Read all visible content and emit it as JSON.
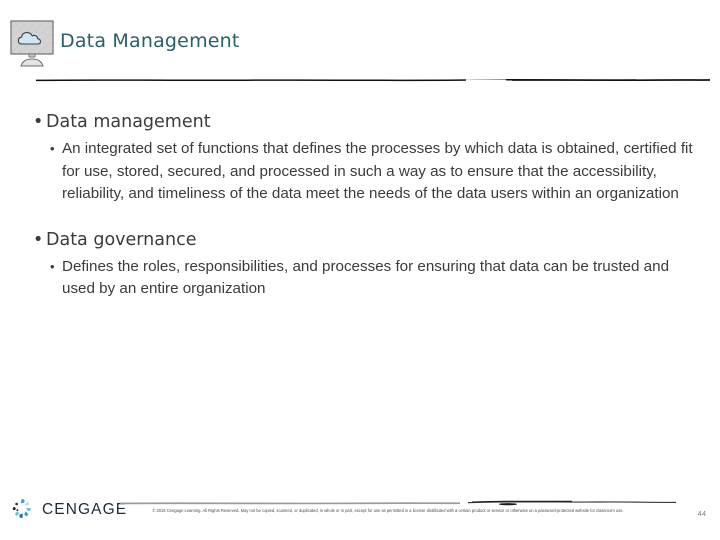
{
  "slide": {
    "header": {
      "title": "Data Management",
      "icon": "cloud-monitor-icon",
      "title_color": "#27606b"
    },
    "content": [
      {
        "level": 1,
        "bullet_glyph": "•",
        "text": "Data management"
      },
      {
        "level": 2,
        "bullet_glyph": "•",
        "text": "An integrated set of functions that defines the processes by which data is obtained, certified fit for use, stored, secured, and processed in such a way as to ensure that the accessibility, reliability, and timeliness of the data meet the needs of the data users within an organization"
      },
      {
        "level": 1,
        "bullet_glyph": "•",
        "text": "Data governance"
      },
      {
        "level": 2,
        "bullet_glyph": "•",
        "text": "Defines the roles, responsibilities, and processes for ensuring that data can be trusted and used by an entire organization"
      }
    ],
    "footer": {
      "logo_word": "CENGAGE",
      "logo_mark": "cengage-swirl-icon",
      "copyright": "© 2019 Cengage Learning. All Rights Reserved. May not be copied, scanned, or duplicated, in whole or in part, except for use as permitted in a license distributed with a certain product or service or otherwise on a password-protected website for classroom use.",
      "page_number": "44"
    },
    "colors": {
      "title": "#27606b",
      "body_text": "#3b3b3b",
      "rule": "#111111",
      "footer_rule": "#9b9b9b",
      "page_number": "#7d7d7d",
      "logo_word": "#1d2b3a",
      "logo_accent": "#2f9fd0"
    }
  }
}
